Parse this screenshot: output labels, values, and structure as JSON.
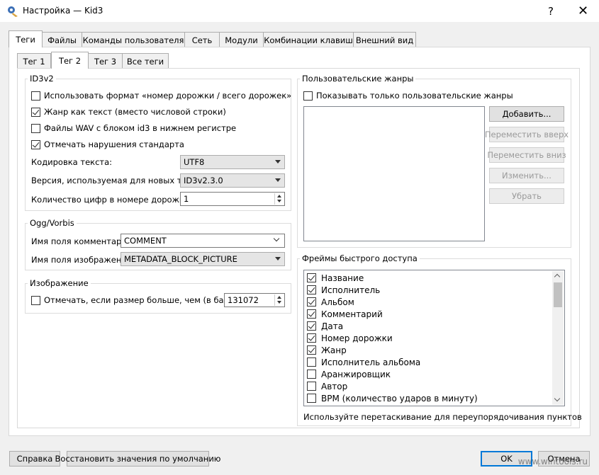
{
  "window": {
    "title": "Настройка — Kid3",
    "help_glyph": "?",
    "close_glyph": "✕"
  },
  "main_tabs": [
    "Теги",
    "Файлы",
    "Команды пользователя",
    "Сеть",
    "Модули",
    "Комбинации клавиш",
    "Внешний вид"
  ],
  "sub_tabs": [
    "Тег 1",
    "Тег 2",
    "Тег 3",
    "Все теги"
  ],
  "id3v2": {
    "title": "ID3v2",
    "options": [
      {
        "label": "Использовать формат «номер дорожки / всего дорожек»",
        "checked": false
      },
      {
        "label": "Жанр как текст (вместо числовой строки)",
        "checked": true
      },
      {
        "label": "Файлы WAV с блоком id3 в нижнем регистре",
        "checked": false
      },
      {
        "label": "Отмечать нарушения стандарта",
        "checked": true
      }
    ],
    "encoding_label": "Кодировка текста:",
    "encoding_value": "UTF8",
    "version_label": "Версия, используемая для новых тегов:",
    "version_value": "ID3v2.3.0",
    "digits_label": "Количество цифр в номере дорожки:",
    "digits_value": "1"
  },
  "ogg": {
    "title": "Ogg/Vorbis",
    "comment_label": "Имя поля комментария:",
    "comment_value": "COMMENT",
    "picture_label": "Имя поля изображения:",
    "picture_value": "METADATA_BLOCK_PICTURE"
  },
  "image": {
    "title": "Изображение",
    "mark_label": "Отмечать, если размер больше, чем (в байтах):",
    "mark_checked": false,
    "size_value": "131072"
  },
  "genres": {
    "title": "Пользовательские жанры",
    "only_custom_label": "Показывать только пользовательские жанры",
    "only_custom_checked": false,
    "buttons": {
      "add": "Добавить...",
      "move_up": "Переместить вверх",
      "move_down": "Переместить вниз",
      "edit": "Изменить...",
      "remove": "Убрать"
    }
  },
  "quick_frames": {
    "title": "Фреймы быстрого доступа",
    "items": [
      {
        "label": "Название",
        "checked": true
      },
      {
        "label": "Исполнитель",
        "checked": true
      },
      {
        "label": "Альбом",
        "checked": true
      },
      {
        "label": "Комментарий",
        "checked": true
      },
      {
        "label": "Дата",
        "checked": true
      },
      {
        "label": "Номер дорожки",
        "checked": true
      },
      {
        "label": "Жанр",
        "checked": true
      },
      {
        "label": "Исполнитель альбома",
        "checked": false
      },
      {
        "label": "Аранжировщик",
        "checked": false
      },
      {
        "label": "Автор",
        "checked": false
      },
      {
        "label": "BPM (количество ударов в минуту)",
        "checked": false
      }
    ],
    "hint": "Используйте перетаскивание для переупорядочивания пунктов"
  },
  "footer": {
    "help": "Справка",
    "restore": "Восстановить значения по умолчанию",
    "ok": "OK",
    "cancel": "Отмена"
  },
  "watermark": "www.wintools.ru"
}
